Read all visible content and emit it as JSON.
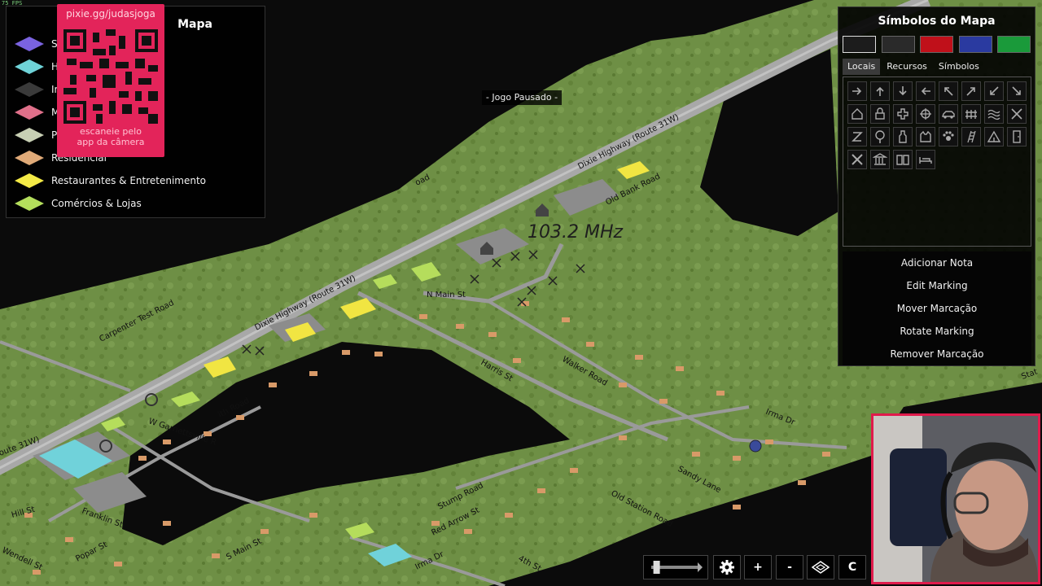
{
  "fps_text": "75 FPS",
  "legend": {
    "title": "Mapa",
    "items": [
      {
        "label": "S",
        "color": "#7a63e0"
      },
      {
        "label": "H",
        "color": "#6fd3d8"
      },
      {
        "label": "Ir",
        "color": "#3a3a3a"
      },
      {
        "label": "M",
        "color": "#e0708a"
      },
      {
        "label": "P",
        "color": "#c8d0b4"
      },
      {
        "label": "Residencial",
        "color": "#e0aa78"
      },
      {
        "label": "Restaurantes & Entretenimento",
        "color": "#f4ea46"
      },
      {
        "label": "Comércios & Lojas",
        "color": "#b4de5c"
      }
    ]
  },
  "qr_overlay": {
    "url": "pixie.gg/judasjoga",
    "caption_line1": "escaneie pelo",
    "caption_line2": "app da câmera"
  },
  "pause_text": "- Jogo Pausado -",
  "radio_label": "103.2 MHz",
  "map_labels": [
    "Dixie Highway (Route 31W)",
    "Old Bank Road",
    "N Main St",
    "Dixie Highway (Route 31W)",
    "Carpenter Test Road",
    "Harris St",
    "Walker Road",
    "Irma Dr",
    "Sandy Lane",
    "Old Station Road",
    "W Garnettsville R",
    "ith Road",
    "Hill St",
    "Franklin St",
    "Stump Road",
    "Red Arrow St",
    "S Main St",
    "Popar St",
    "Wendell St",
    "Irma Dr",
    "4th St",
    "Stat",
    "oute 31W)",
    "oad"
  ],
  "symbols_panel": {
    "title": "Símbolos do Mapa",
    "colors": [
      "#1c1c1c",
      "#2a2a2a",
      "#c0101a",
      "#2a3aa0",
      "#1a9a3a"
    ],
    "tabs": [
      {
        "label": "Locais",
        "active": true
      },
      {
        "label": "Recursos",
        "active": false
      },
      {
        "label": "Símbolos",
        "active": false
      }
    ],
    "icons": [
      "arrow-right-icon",
      "arrow-up-icon",
      "arrow-down-icon",
      "arrow-left-icon",
      "arrow-up-left-icon",
      "arrow-up-right-icon",
      "arrow-down-left-icon",
      "arrow-down-right-icon",
      "house-icon",
      "lock-icon",
      "medical-cross-icon",
      "crosshair-icon",
      "vehicle-icon",
      "fence-icon",
      "water-icon",
      "x-mark-icon",
      "z-sleep-icon",
      "tree-icon",
      "bottle-icon",
      "cat-icon",
      "paw-icon",
      "ladder-icon",
      "tent-icon",
      "door-icon",
      "tools-icon",
      "bank-icon",
      "book-icon",
      "bed-icon"
    ],
    "actions": [
      "Adicionar Nota",
      "Edit Marking",
      "Mover Marcação",
      "Rotate Marking",
      "Remover Marcação"
    ]
  },
  "toolbar": {
    "zoom_slider_level": 0.05,
    "settings_icon": "gear-icon",
    "zoom_in": "+",
    "zoom_out": "-",
    "layers_icon": "layers-icon",
    "center": "C"
  }
}
